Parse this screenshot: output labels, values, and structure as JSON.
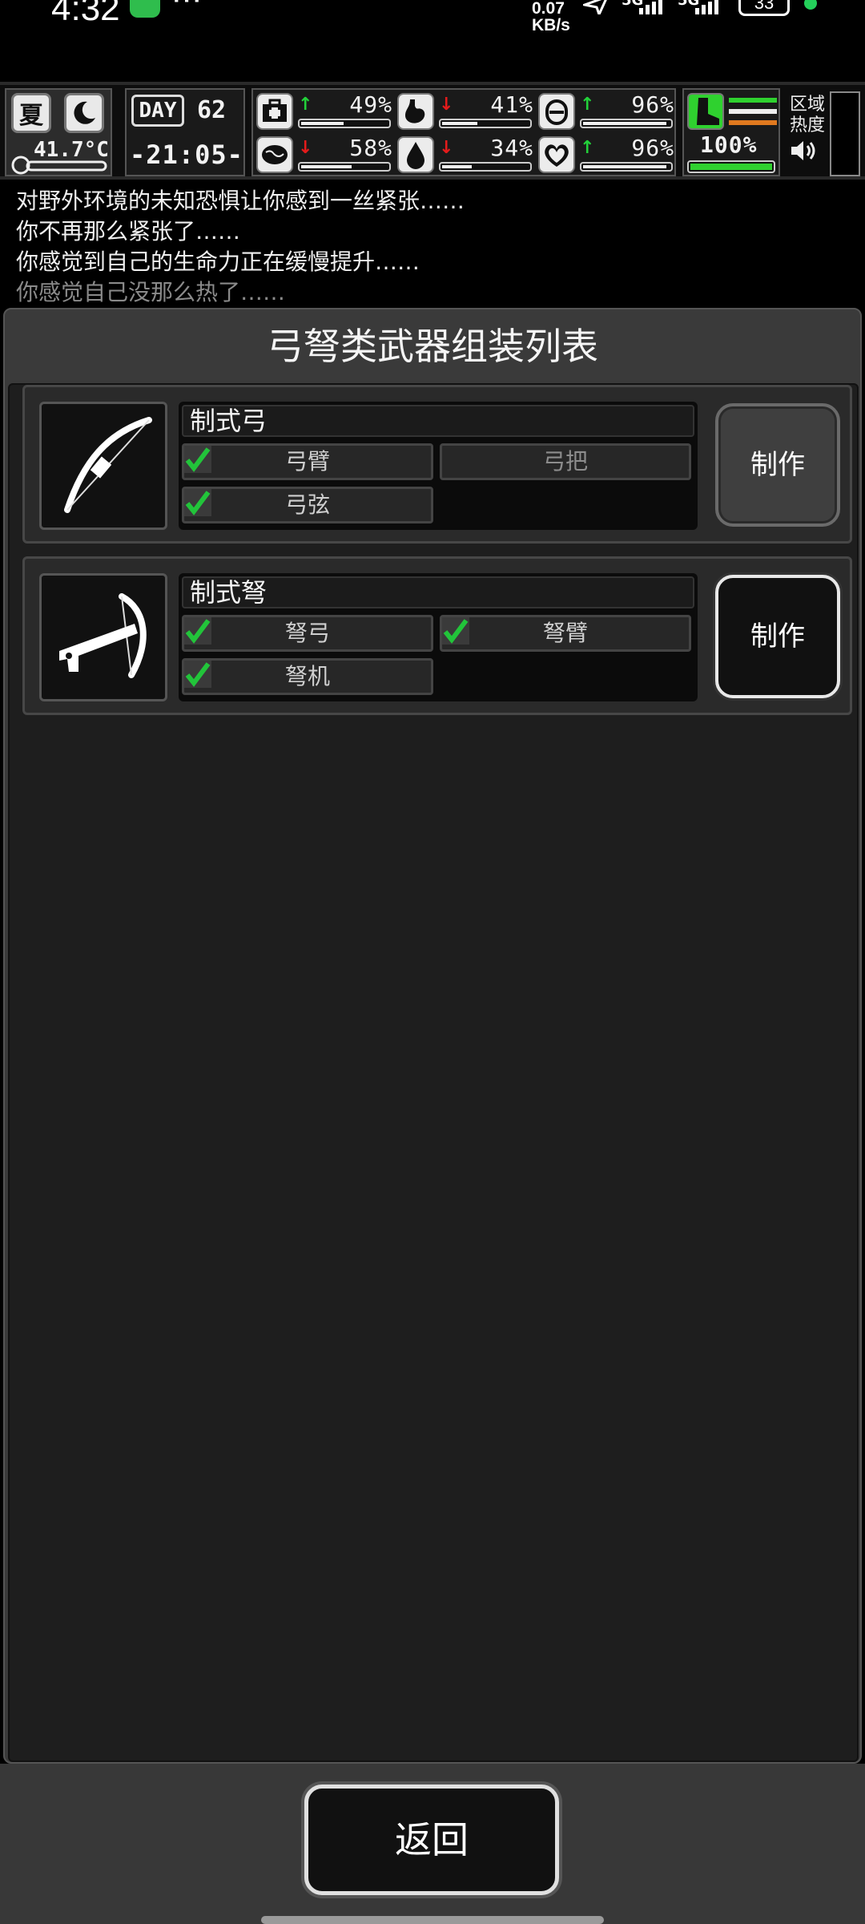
{
  "status_bar": {
    "time": "4:32",
    "more": "···",
    "net_speed_value": "0.07",
    "net_speed_unit": "KB/s",
    "signal_1": "5G",
    "signal_2": "5G",
    "battery": "33"
  },
  "hud": {
    "season": "夏",
    "temperature": "41.7°C",
    "day_label": "DAY",
    "day_number": "62",
    "clock": "-21:05-",
    "stats": [
      {
        "name": "health",
        "arrow": "↑",
        "arrow_color": "#22d13a",
        "value": "49%",
        "level": 0.49
      },
      {
        "name": "hunger",
        "arrow": "↓",
        "arrow_color": "#e41b1b",
        "value": "41%",
        "level": 0.41
      },
      {
        "name": "stamina",
        "arrow": "↑",
        "arrow_color": "#22d13a",
        "value": "96%",
        "level": 0.96
      },
      {
        "name": "sanity",
        "arrow": "↓",
        "arrow_color": "#e41b1b",
        "value": "58%",
        "level": 0.58
      },
      {
        "name": "thirst",
        "arrow": "↓",
        "arrow_color": "#e41b1b",
        "value": "34%",
        "level": 0.34
      },
      {
        "name": "heart",
        "arrow": "↑",
        "arrow_color": "#22d13a",
        "value": "96%",
        "level": 0.96
      }
    ],
    "boot_value": "100%",
    "boot_level": 1.0,
    "region_heat_label": "区域热度"
  },
  "log": [
    "对野外环境的未知恐惧让你感到一丝紧张……",
    "你不再那么紧张了……",
    "你感觉到自己的生命力正在缓慢提升……",
    "你感觉自己没那么热了……"
  ],
  "panel": {
    "title": "弓弩类武器组装列表",
    "recipes": [
      {
        "name": "制式弓",
        "parts": [
          {
            "label": "弓臂",
            "have": true
          },
          {
            "label": "弓把",
            "have": false
          },
          {
            "label": "弓弦",
            "have": true
          }
        ],
        "make_label": "制作"
      },
      {
        "name": "制式弩",
        "parts": [
          {
            "label": "弩弓",
            "have": true
          },
          {
            "label": "弩臂",
            "have": true
          },
          {
            "label": "弩机",
            "have": true
          }
        ],
        "make_label": "制作"
      }
    ]
  },
  "footer": {
    "back_label": "返回"
  },
  "colors": {
    "check_green": "#22c43a",
    "boot_green": "#2fd12f",
    "stripe_orange": "#e0791f"
  }
}
